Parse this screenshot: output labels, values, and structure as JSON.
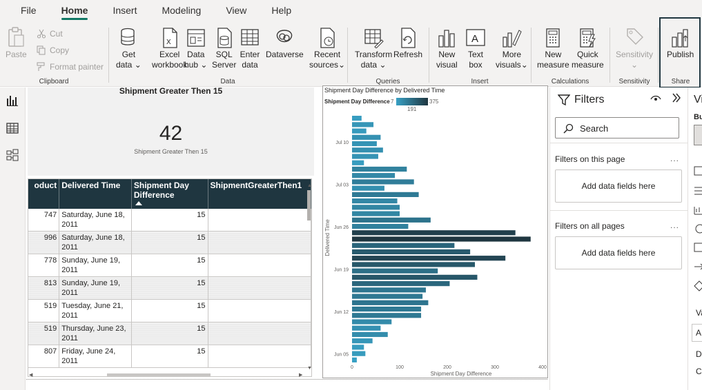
{
  "menu": {
    "tabs": [
      {
        "label": "File"
      },
      {
        "label": "Home"
      },
      {
        "label": "Insert"
      },
      {
        "label": "Modeling"
      },
      {
        "label": "View"
      },
      {
        "label": "Help"
      }
    ],
    "active_tab": "Home"
  },
  "ribbon": {
    "clipboard": {
      "group_label": "Clipboard",
      "paste": "Paste",
      "cut": "Cut",
      "copy": "Copy",
      "format_painter": "Format painter"
    },
    "data": {
      "group_label": "Data",
      "get_data": [
        "Get",
        "data"
      ],
      "excel": [
        "Excel",
        "workbook"
      ],
      "data_hub": [
        "Data",
        "hub"
      ],
      "sql": [
        "SQL",
        "Server"
      ],
      "enter_data": [
        "Enter",
        "data"
      ],
      "dataverse": "Dataverse",
      "recent_sources": [
        "Recent",
        "sources"
      ]
    },
    "queries": {
      "group_label": "Queries",
      "transform": [
        "Transform",
        "data"
      ],
      "refresh": "Refresh"
    },
    "insert": {
      "group_label": "Insert",
      "new_visual": [
        "New",
        "visual"
      ],
      "text_box": [
        "Text",
        "box"
      ],
      "more_visuals": [
        "More",
        "visuals"
      ]
    },
    "calculations": {
      "group_label": "Calculations",
      "new_measure": [
        "New",
        "measure"
      ],
      "quick_measure": [
        "Quick",
        "measure"
      ]
    },
    "sensitivity": {
      "group_label": "Sensitivity",
      "label": "Sensitivity"
    },
    "share": {
      "group_label": "Share",
      "publish": "Publish"
    }
  },
  "card": {
    "title": "Shipment Greater Then 15",
    "value": "42",
    "subtitle": "Shipment Greater Then 15"
  },
  "table": {
    "headers": [
      "oduct",
      "Delivered Time",
      "Shipment Day Difference",
      "ShipmentGreaterThen1"
    ],
    "rows": [
      {
        "product": "747",
        "delivered": [
          "Saturday, June 18,",
          "2011"
        ],
        "diff": "15"
      },
      {
        "product": "996",
        "delivered": [
          "Saturday, June 18,",
          "2011"
        ],
        "diff": "15"
      },
      {
        "product": "778",
        "delivered": [
          "Sunday, June 19,",
          "2011"
        ],
        "diff": "15"
      },
      {
        "product": "813",
        "delivered": [
          "Sunday, June 19,",
          "2011"
        ],
        "diff": "15"
      },
      {
        "product": "519",
        "delivered": [
          "Tuesday, June 21,",
          "2011"
        ],
        "diff": "15"
      },
      {
        "product": "519",
        "delivered": [
          "Thursday, June 23,",
          "2011"
        ],
        "diff": "15"
      },
      {
        "product": "807",
        "delivered": [
          "Friday, June 24,",
          "2011"
        ],
        "diff": "15"
      }
    ]
  },
  "chart_data": {
    "type": "bar",
    "orientation": "horizontal",
    "title": "Shipment Day Difference by Delivered Time",
    "xlabel": "Shipment Day Difference",
    "ylabel": "Delivered Time",
    "xlim": [
      0,
      400
    ],
    "x_ticks": [
      "0",
      "100",
      "200",
      "300",
      "400"
    ],
    "y_ticks": [
      "Jul 10",
      "Jul 03",
      "Jun 26",
      "Jun 19",
      "Jun 12",
      "Jun 05"
    ],
    "legend": {
      "title": "Shipment Day Difference",
      "min": "7",
      "mid": "191",
      "max": "375"
    },
    "color_scale": [
      "#38a0c4",
      "#1f3640"
    ],
    "values": [
      20,
      45,
      30,
      60,
      52,
      65,
      55,
      25,
      115,
      90,
      130,
      68,
      140,
      95,
      100,
      100,
      165,
      118,
      343,
      375,
      215,
      248,
      322,
      258,
      180,
      263,
      205,
      155,
      148,
      160,
      145,
      145,
      83,
      60,
      75,
      43,
      25,
      28,
      10
    ]
  },
  "filters": {
    "title": "Filters",
    "search_placeholder": "Search",
    "on_this_page": "Filters on this page",
    "on_all_pages": "Filters on all pages",
    "add_fields": "Add data fields here",
    "add_fields_2": "Add data fields here",
    "more": "..."
  },
  "viz_pane": {
    "title": "Vi",
    "build_label": "Bu",
    "values_label": "Va",
    "field_a": "A",
    "item_d": "D",
    "item_c": "C"
  }
}
